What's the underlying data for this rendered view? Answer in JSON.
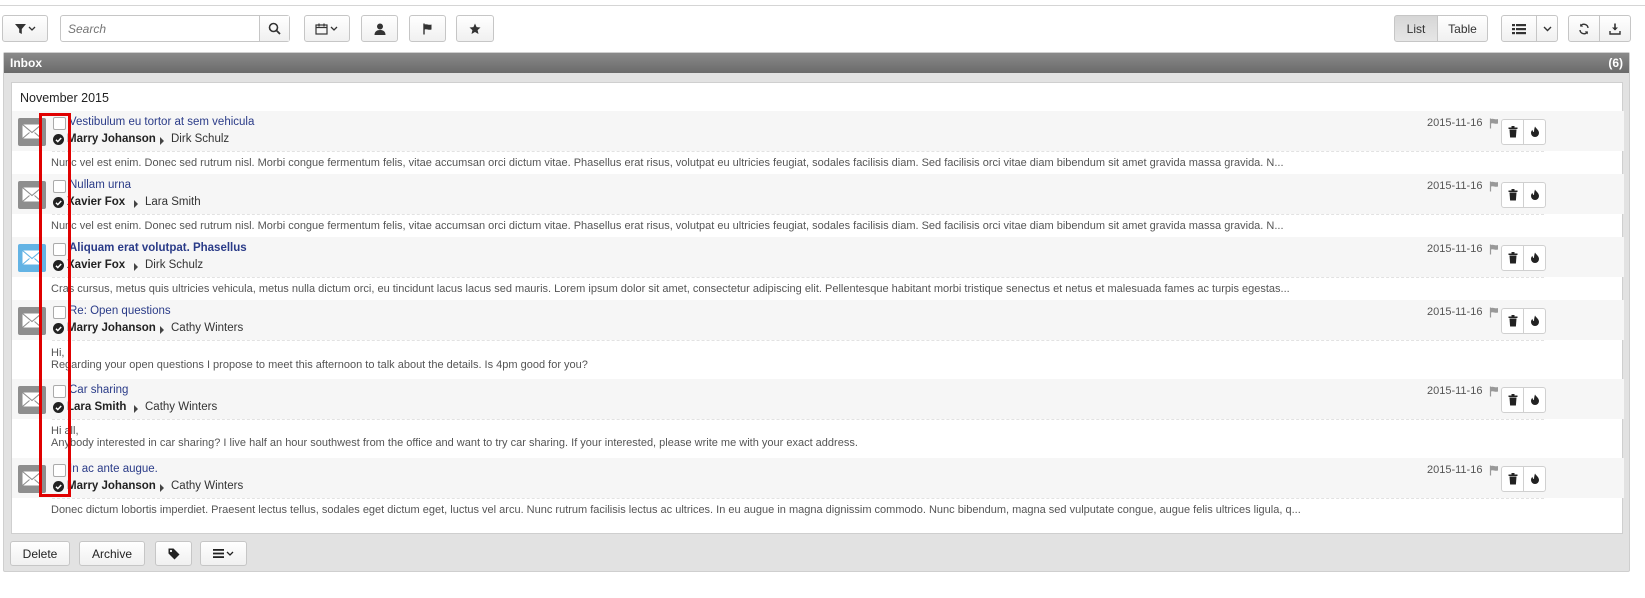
{
  "toolbar": {
    "search_placeholder": "Search",
    "view_list": "List",
    "view_table": "Table"
  },
  "inbox": {
    "title": "Inbox",
    "count": "(6)",
    "month": "November 2015"
  },
  "mails": [
    {
      "subject": "Vestibulum eu tortor at sem vehicula",
      "from": "Marry Johanson",
      "to": "Dirk Schulz",
      "date": "2015-11-16",
      "unread": false,
      "preview": [
        "Nunc vel est enim. Donec sed rutrum nisl. Morbi congue fermentum felis, vitae accumsan orci dictum vitae. Phasellus erat risus, volutpat eu ultricies feugiat, sodales facilisis diam. Sed facilisis orci vitae diam bibendum sit amet gravida massa gravida. N..."
      ]
    },
    {
      "subject": "Nullam urna",
      "from": "Xavier Fox",
      "to": "Lara Smith",
      "date": "2015-11-16",
      "unread": false,
      "preview": [
        "Nunc vel est enim. Donec sed rutrum nisl. Morbi congue fermentum felis, vitae accumsan orci dictum vitae. Phasellus erat risus, volutpat eu ultricies feugiat, sodales facilisis diam. Sed facilisis orci vitae diam bibendum sit amet gravida massa gravida. N..."
      ]
    },
    {
      "subject": "Aliquam erat volutpat. Phasellus",
      "from": "Xavier Fox",
      "to": "Dirk Schulz",
      "date": "2015-11-16",
      "unread": true,
      "preview": [
        "Cras cursus, metus quis ultricies vehicula, metus nulla dictum orci, eu tincidunt lacus lacus sed mauris. Lorem ipsum dolor sit amet, consectetur adipiscing elit. Pellentesque habitant morbi tristique senectus et netus et malesuada fames ac turpis egestas..."
      ]
    },
    {
      "subject": "Re: Open questions",
      "from": "Marry Johanson",
      "to": "Cathy Winters",
      "date": "2015-11-16",
      "unread": false,
      "preview": [
        "Hi,",
        "Regarding your open questions I propose to meet this afternoon to talk about the details. Is 4pm good for you?"
      ]
    },
    {
      "subject": "Car sharing",
      "from": "Lara Smith",
      "to": "Cathy Winters",
      "date": "2015-11-16",
      "unread": false,
      "preview": [
        "Hi all,",
        "Anybody interested in car sharing? I live half an hour southwest from the office and want to try car sharing. If your interested, please write me with your exact address."
      ]
    },
    {
      "subject": "In ac ante augue.",
      "from": "Marry Johanson",
      "to": "Cathy Winters",
      "date": "2015-11-16",
      "unread": false,
      "preview": [
        "Donec dictum lobortis imperdiet. Praesent lectus tellus, sodales eget dictum eget, luctus vel arcu. Nunc rutrum facilisis lectus ac ultrices. In eu augue in magna dignissim commodo. Nunc bibendum, magna sed vulputate congue, augue felis ultrices ligula, q..."
      ]
    }
  ],
  "footer": {
    "delete_label": "Delete",
    "archive_label": "Archive"
  },
  "icons": {
    "filter": "filter-icon",
    "search": "search-icon",
    "calendar": "calendar-icon",
    "person": "person-icon",
    "flag": "flag-icon",
    "star": "star-icon",
    "list": "list-icon",
    "refresh": "refresh-icon",
    "download": "download-icon",
    "envelope": "envelope-icon",
    "trash": "trash-icon",
    "fire": "fire-icon",
    "tag": "tag-icon",
    "menu": "menu-icon"
  },
  "colors": {
    "subject_link": "#2a3b88",
    "unread_envelope": "#63b3e4",
    "read_envelope": "#8e8e8e",
    "highlight_box": "#e00000"
  }
}
